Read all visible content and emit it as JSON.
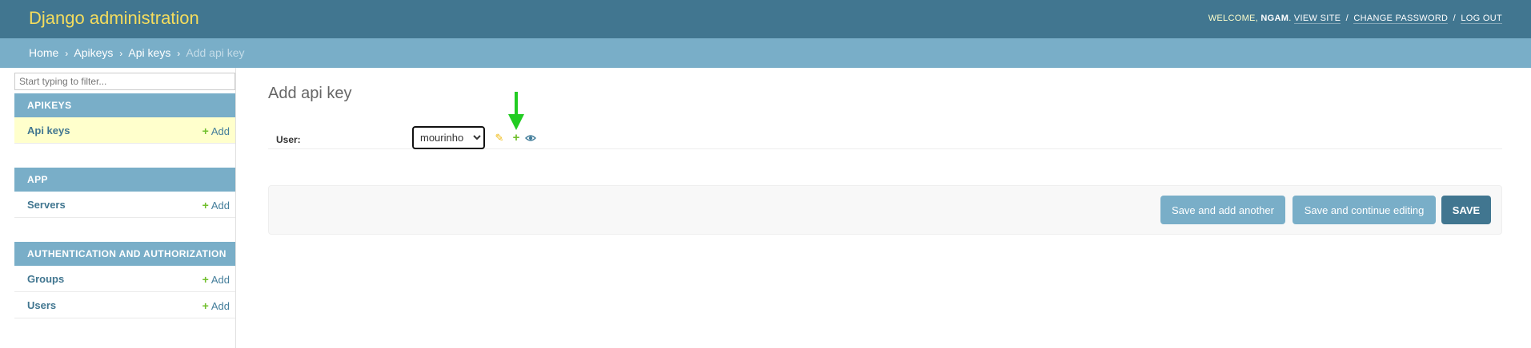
{
  "header": {
    "brand": "Django administration",
    "welcome_prefix": "WELCOME,",
    "username": "NGAM",
    "welcome_suffix": ".",
    "view_site": "VIEW SITE",
    "change_password": "CHANGE PASSWORD",
    "log_out": "LOG OUT",
    "separator": "/"
  },
  "breadcrumbs": {
    "items": [
      "Home",
      "Apikeys",
      "Api keys"
    ],
    "current": "Add api key",
    "separator": "›"
  },
  "sidebar": {
    "filter_placeholder": "Start typing to filter...",
    "modules": [
      {
        "caption": "APIKEYS",
        "rows": [
          {
            "name": "Api keys",
            "add": "Add",
            "current": true
          }
        ]
      },
      {
        "caption": "APP",
        "rows": [
          {
            "name": "Servers",
            "add": "Add"
          }
        ]
      },
      {
        "caption": "AUTHENTICATION AND AUTHORIZATION",
        "rows": [
          {
            "name": "Groups",
            "add": "Add"
          },
          {
            "name": "Users",
            "add": "Add"
          }
        ]
      }
    ],
    "add_icon": "plus-icon"
  },
  "content": {
    "title": "Add api key",
    "field_label": "User:",
    "user_selected": "mourinho",
    "icons": {
      "change": "pencil-icon",
      "add": "plus-icon",
      "view": "eye-icon"
    }
  },
  "annotation": {
    "icon": "arrow-down-icon",
    "color": "#22cc22"
  },
  "submit": {
    "save_add_another": "Save and add another",
    "save_continue": "Save and continue editing",
    "save": "SAVE"
  },
  "colors": {
    "header_bg": "#417690",
    "brand": "#f5dd5d",
    "breadcrumb_bg": "#79aec8",
    "module_caption_bg": "#79aec8",
    "current_row_bg": "#ffffcc",
    "add_plus": "#70bf2b",
    "link": "#417690",
    "button_light": "#79aec8",
    "button_primary": "#417690"
  }
}
